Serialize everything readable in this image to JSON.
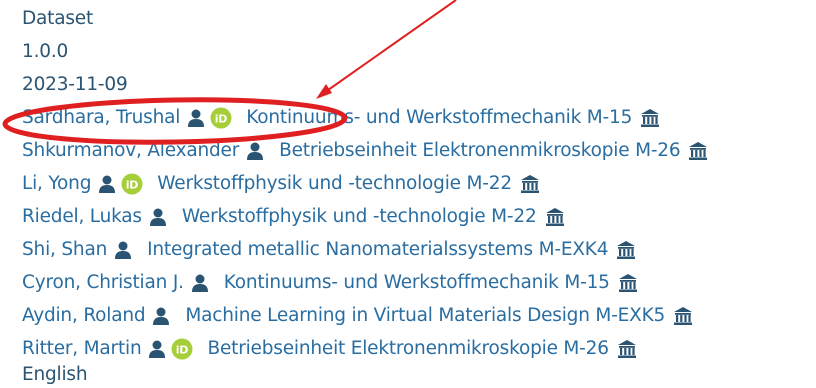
{
  "record": {
    "type": "Dataset",
    "version": "1.0.0",
    "date": "2023-11-09",
    "language": "English"
  },
  "authors": [
    {
      "name": "Sardhara, Trushal",
      "orcid": true,
      "institution": "Kontinuums- und Werkstoffmechanik M-15"
    },
    {
      "name": "Shkurmanov, Alexander",
      "orcid": false,
      "institution": "Betriebseinheit Elektronenmikroskopie M-26"
    },
    {
      "name": "Li, Yong",
      "orcid": true,
      "institution": "Werkstoffphysik und -technologie M-22"
    },
    {
      "name": "Riedel, Lukas",
      "orcid": false,
      "institution": "Werkstoffphysik und -technologie M-22"
    },
    {
      "name": "Shi, Shan",
      "orcid": false,
      "institution": "Integrated metallic Nanomaterialssystems M-EXK4"
    },
    {
      "name": "Cyron, Christian J.",
      "orcid": false,
      "institution": "Kontinuums- und Werkstoffmechanik M-15"
    },
    {
      "name": "Aydin, Roland",
      "orcid": false,
      "institution": "Machine Learning in Virtual Materials Design M-EXK5"
    },
    {
      "name": "Ritter, Martin",
      "orcid": true,
      "institution": "Betriebseinheit Elektronenmikroskopie M-26"
    }
  ],
  "icons": {
    "person": "person-icon",
    "orcid": "orcid-icon",
    "institution": "institution-bank-icon"
  },
  "colors": {
    "text": "#2b5473",
    "link": "#2a6da1",
    "orcid": "#a6ce39",
    "annotation": "#e02020"
  }
}
